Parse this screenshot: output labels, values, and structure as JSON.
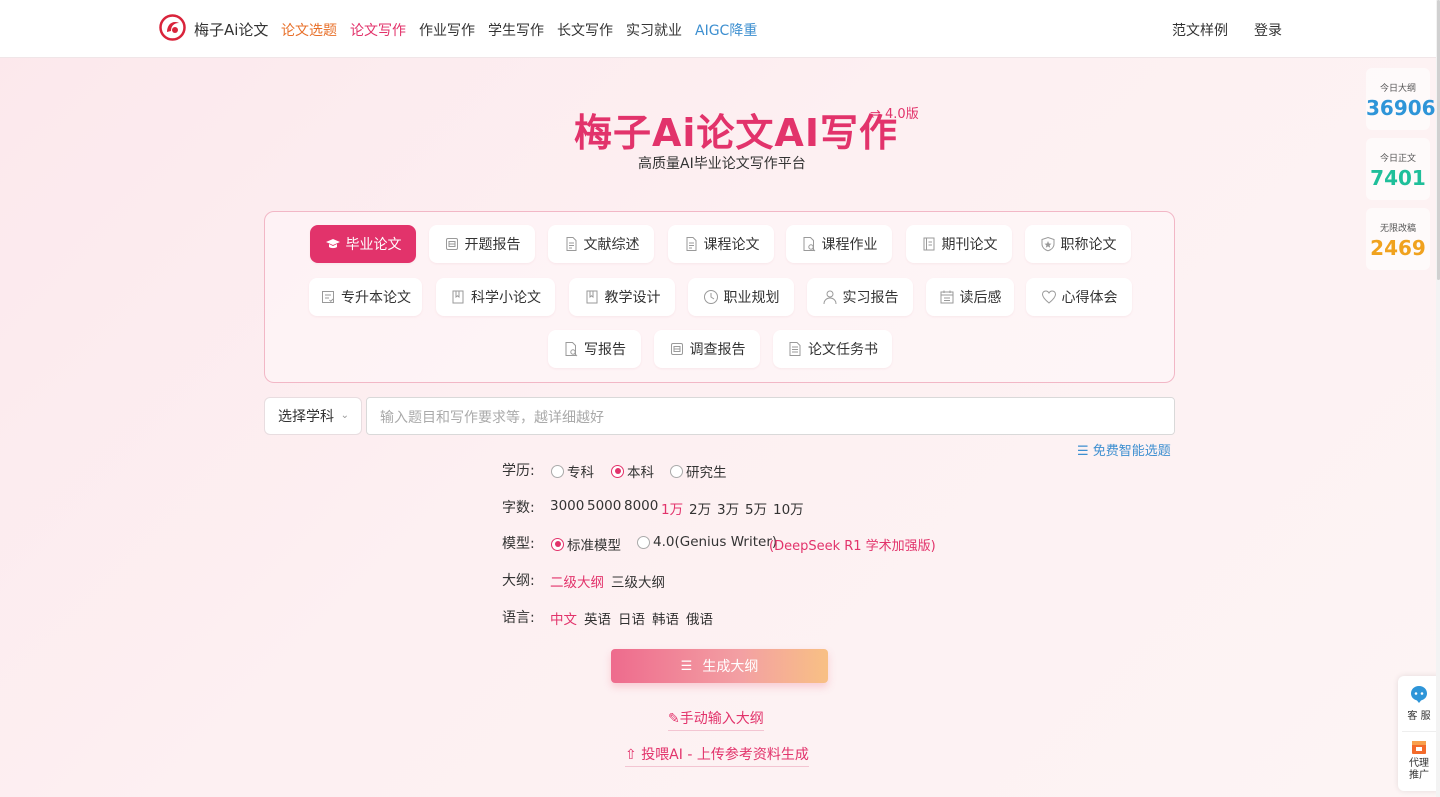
{
  "nav": {
    "brand": "梅子Ai论文",
    "links": [
      {
        "label": "论文选题",
        "color": "#e8702a"
      },
      {
        "label": "论文写作",
        "color": "#e2336b"
      },
      {
        "label": "作业写作",
        "color": "#333333"
      },
      {
        "label": "学生写作",
        "color": "#333333"
      },
      {
        "label": "长文写作",
        "color": "#333333"
      },
      {
        "label": "实习就业",
        "color": "#333333"
      },
      {
        "label": "AIGC降重",
        "color": "#3d8fd0"
      }
    ],
    "right": [
      "范文样例",
      "登录"
    ]
  },
  "hero": {
    "title": "梅子Ai论文AI写作",
    "version": "⇌ 4.0版",
    "subtitle": "高质量AI毕业论文写作平台"
  },
  "types": [
    {
      "label": "毕业论文",
      "icon": "graduation-cap-icon",
      "active": true
    },
    {
      "label": "开题报告",
      "icon": "report-icon"
    },
    {
      "label": "文献综述",
      "icon": "document-icon"
    },
    {
      "label": "课程论文",
      "icon": "document-icon"
    },
    {
      "label": "课程作业",
      "icon": "document-search-icon"
    },
    {
      "label": "期刊论文",
      "icon": "journal-icon"
    },
    {
      "label": "职称论文",
      "icon": "shield-icon"
    },
    {
      "label": "专升本论文",
      "icon": "checklist-icon"
    },
    {
      "label": "科学小论文",
      "icon": "bookmark-icon"
    },
    {
      "label": "教学设计",
      "icon": "bookmark-icon"
    },
    {
      "label": "职业规划",
      "icon": "clock-icon"
    },
    {
      "label": "实习报告",
      "icon": "user-icon"
    },
    {
      "label": "读后感",
      "icon": "calendar-icon"
    },
    {
      "label": "心得体会",
      "icon": "heart-icon"
    },
    {
      "label": "写报告",
      "icon": "document-search-icon"
    },
    {
      "label": "调查报告",
      "icon": "report-icon"
    },
    {
      "label": "论文任务书",
      "icon": "list-icon"
    }
  ],
  "input": {
    "subject": "选择学科",
    "placeholder": "输入题目和写作要求等，越详细越好",
    "smart_pick": "免费智能选题"
  },
  "options": {
    "education": {
      "label": "学历:",
      "choices": [
        "专科",
        "本科",
        "研究生"
      ],
      "selected": "本科"
    },
    "words": {
      "label": "字数:",
      "choices": [
        "3000",
        "5000",
        "8000",
        "1万",
        "2万",
        "3万",
        "5万",
        "10万"
      ],
      "selected": "1万"
    },
    "model": {
      "label": "模型:",
      "choices": [
        "标准模型",
        "4.0(Genius Writer)"
      ],
      "selected": "标准模型",
      "note": "(DeepSeek R1 学术加强版)"
    },
    "outline": {
      "label": "大纲:",
      "choices": [
        "二级大纲",
        "三级大纲"
      ],
      "selected": "二级大纲"
    },
    "language": {
      "label": "语言:",
      "choices": [
        "中文",
        "英语",
        "日语",
        "韩语",
        "俄语"
      ],
      "selected": "中文"
    }
  },
  "actions": {
    "generate": "生成大纲",
    "manual": "手动输入大纲",
    "upload": "投喂AI - 上传参考资料生成"
  },
  "stats": [
    {
      "label": "今日大纲",
      "value": "36906",
      "color": "#2e95d8"
    },
    {
      "label": "今日正文",
      "value": "7401",
      "color": "#1fbf9a"
    },
    {
      "label": "无限改稿",
      "value": "2469",
      "color": "#f0a21e"
    }
  ],
  "dock": {
    "service": "客 服",
    "agent_line1": "代理",
    "agent_line2": "推广"
  },
  "colors": {
    "accent": "#e2336b",
    "link_blue": "#3d8fd0"
  }
}
